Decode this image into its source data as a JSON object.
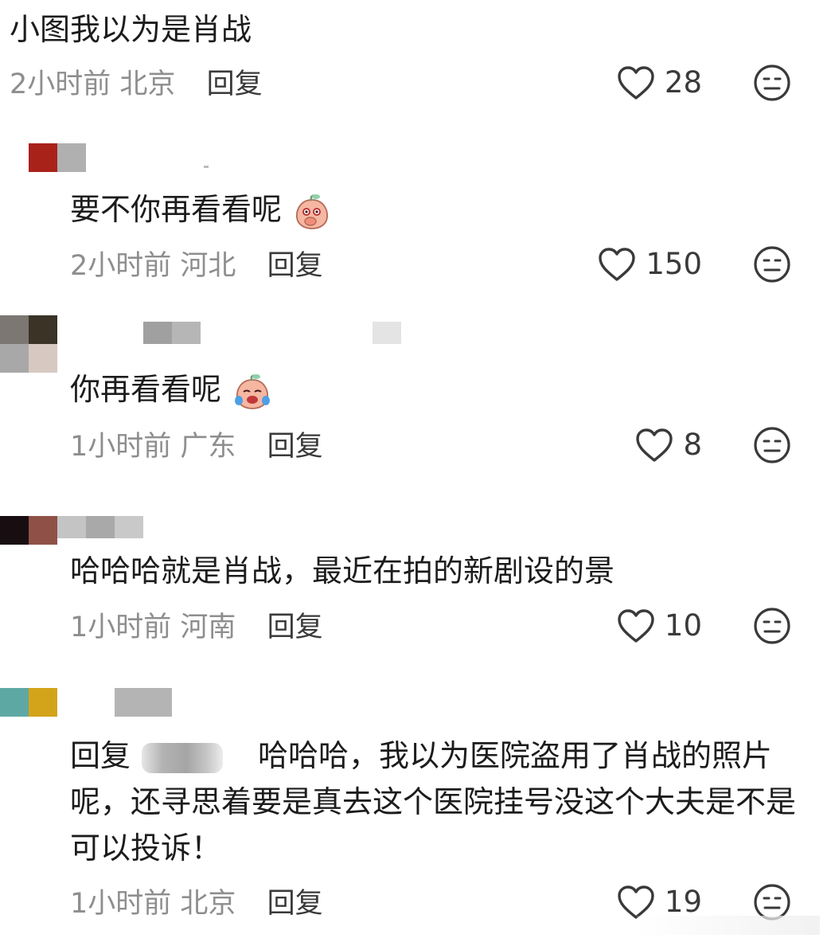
{
  "comments": [
    {
      "text": "小图我以为是肖战",
      "time": "2小时前",
      "location": "北京",
      "reply_label": "回复",
      "likes": "28"
    },
    {
      "text": "要不你再看看呢",
      "emoji": "peach-shy-emoji",
      "time": "2小时前",
      "location": "河北",
      "reply_label": "回复",
      "likes": "150"
    },
    {
      "text": "你再看看呢",
      "emoji": "peach-crying-emoji",
      "time": "1小时前",
      "location": "广东",
      "reply_label": "回复",
      "likes": "8"
    },
    {
      "text": "哈哈哈就是肖战，最近在拍的新剧设的景",
      "time": "1小时前",
      "location": "河南",
      "reply_label": "回复",
      "likes": "10"
    },
    {
      "reply_prefix": "回复",
      "text": "哈哈哈，我以为医院盗用了肖战的照片呢，还寻思着要是真去这个医院挂号没这个大夫是不是可以投诉！",
      "time": "1小时前",
      "location": "北京",
      "reply_label": "回复",
      "likes": "19"
    }
  ],
  "icons": {
    "like": "heart-outline-icon",
    "dislike": "neutral-face-icon"
  }
}
